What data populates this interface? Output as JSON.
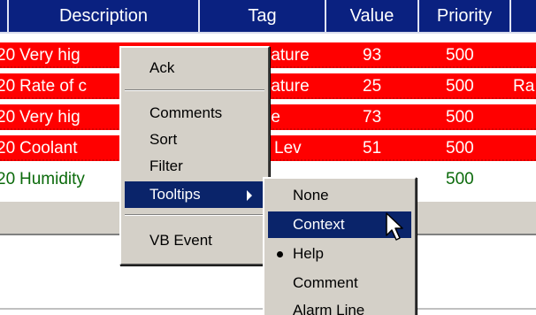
{
  "columns": [
    "Description",
    "Tag",
    "Value",
    "Priority"
  ],
  "rows": [
    {
      "date": "20",
      "description": "Very hig",
      "tag": "rature",
      "value": "93",
      "priority": "500",
      "extra": ""
    },
    {
      "date": "20",
      "description": "Rate of c",
      "tag": "rature",
      "value": "25",
      "priority": "500",
      "extra": "Ra"
    },
    {
      "date": "20",
      "description": "Very hig",
      "tag": "re",
      "value": "73",
      "priority": "500",
      "extra": ""
    },
    {
      "date": "20",
      "description": "Coolant",
      "tag": "Lev",
      "value": "51",
      "priority": "500",
      "extra": ""
    },
    {
      "date": "20",
      "description": "Humidity",
      "tag": "",
      "value": "",
      "priority": "500",
      "extra": ""
    }
  ],
  "context_menu": {
    "ack": "Ack",
    "comments": "Comments",
    "sort": "Sort",
    "filter": "Filter",
    "tooltips": "Tooltips",
    "vb_event": "VB Event"
  },
  "submenu": {
    "none": "None",
    "context": "Context",
    "help": "Help",
    "comment": "Comment",
    "alarm_line": "Alarm Line"
  },
  "colors": {
    "header": "#0a2180",
    "alarm_row": "#ff0000",
    "normal_text": "#0b6a0b",
    "menu_bg": "#d4d0c8",
    "highlight": "#0a246a"
  }
}
